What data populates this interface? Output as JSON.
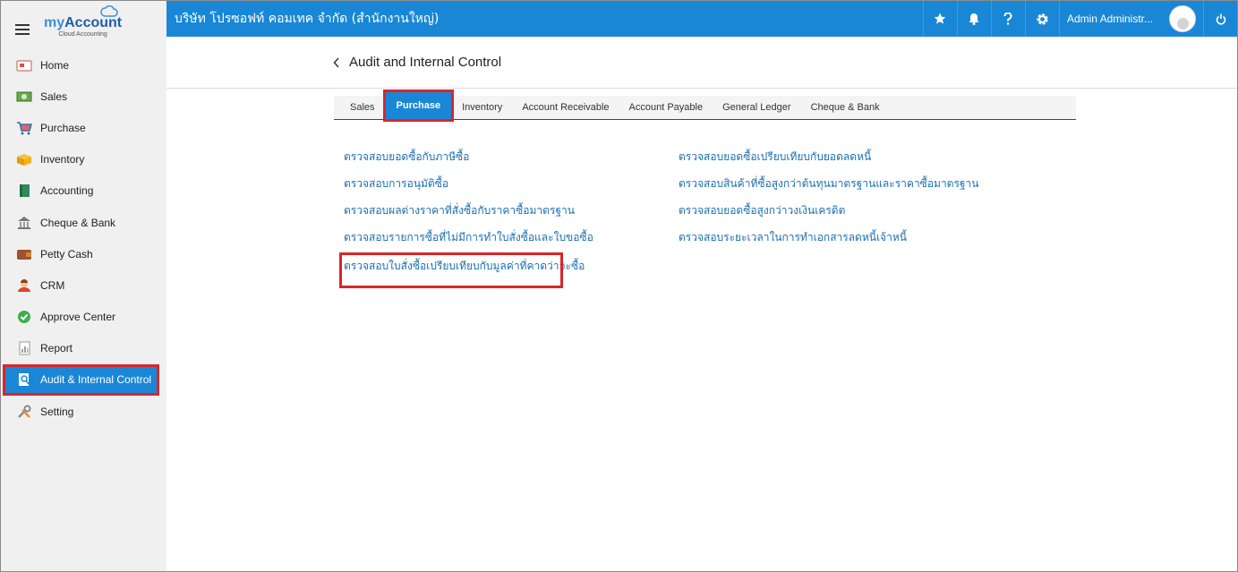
{
  "brand": {
    "name_prefix": "my",
    "name_suffix": "Account",
    "tagline": "Cloud Accounting"
  },
  "sidebar": {
    "items": [
      {
        "label": "Home",
        "icon": "home-icon"
      },
      {
        "label": "Sales",
        "icon": "money-icon"
      },
      {
        "label": "Purchase",
        "icon": "cart-icon"
      },
      {
        "label": "Inventory",
        "icon": "box-icon"
      },
      {
        "label": "Accounting",
        "icon": "ledger-icon"
      },
      {
        "label": "Cheque & Bank",
        "icon": "bank-icon"
      },
      {
        "label": "Petty Cash",
        "icon": "wallet-icon"
      },
      {
        "label": "CRM",
        "icon": "crm-icon"
      },
      {
        "label": "Approve Center",
        "icon": "check-circle-icon"
      },
      {
        "label": "Report",
        "icon": "report-icon"
      },
      {
        "label": "Audit & Internal Control",
        "icon": "audit-icon",
        "active": true
      },
      {
        "label": "Setting",
        "icon": "tools-icon"
      }
    ]
  },
  "topbar": {
    "company": "บริษัท โปรซอฟท์ คอมเทค จำกัด (สำนักงานใหญ่)",
    "user": "Admin Administr...",
    "icons": [
      "star-icon",
      "bell-icon",
      "help-icon",
      "gear-icon",
      "power-icon"
    ]
  },
  "header": {
    "title": "Audit and Internal Control"
  },
  "tabs": [
    {
      "label": "Sales"
    },
    {
      "label": "Purchase",
      "active": true
    },
    {
      "label": "Inventory"
    },
    {
      "label": "Account Receivable"
    },
    {
      "label": "Account Payable"
    },
    {
      "label": "General Ledger"
    },
    {
      "label": "Cheque & Bank"
    }
  ],
  "links": {
    "left": [
      "ตรวจสอบยอดซื้อกับภาษีซื้อ",
      "ตรวจสอบการอนุมัติซื้อ",
      "ตรวจสอบผลต่างราคาที่สั่งซื้อกับราคาซื้อมาตรฐาน",
      "ตรวจสอบรายการซื้อที่ไม่มีการทำใบสั่งซื้อและใบขอซื้อ",
      "ตรวจสอบใบสั่งซื้อเปรียบเทียบกับมูลค่าที่คาดว่าจะซื้อ"
    ],
    "right": [
      "ตรวจสอบยอดซื้อเปรียบเทียบกับยอดลดหนี้",
      "ตรวจสอบสินค้าที่ซื้อสูงกว่าต้นทุนมาตรฐานและราคาซื้อมาตรฐาน",
      "ตรวจสอบยอดซื้อสูงกว่าวงเงินเครดิต",
      "ตรวจสอบระยะเวลาในการทำเอกสารลดหนี้เจ้าหนี้"
    ]
  },
  "colors": {
    "accent": "#1a87d6",
    "highlight": "#d9262b",
    "link": "#1a6fb4"
  }
}
